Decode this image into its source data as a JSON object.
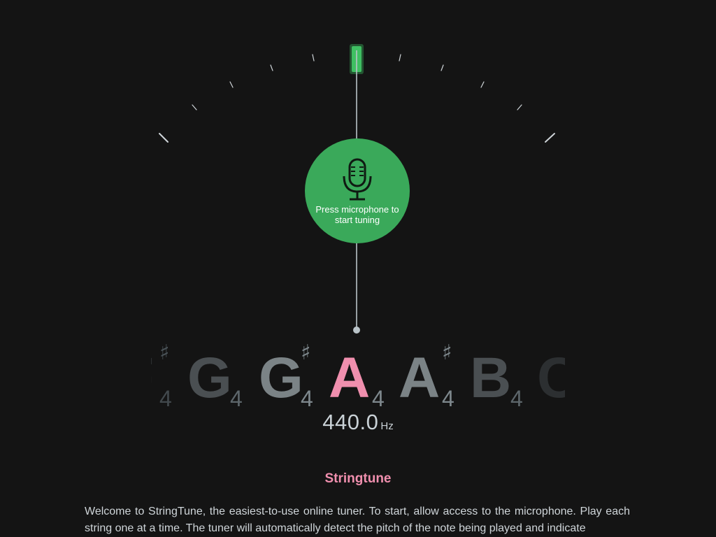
{
  "colors": {
    "background": "#141414",
    "accent_green": "#3aa95a",
    "active_note_pink": "#f08fae",
    "tick": "#cfd5d9",
    "needle": "#b9c3c8",
    "text": "#cfd5d9"
  },
  "tuner": {
    "mic_button": {
      "icon": "microphone-icon",
      "label": "Press microphone to start tuning"
    },
    "notes": [
      {
        "letter": "F",
        "sharp": "♯",
        "octave": "4",
        "state": "faded"
      },
      {
        "letter": "G",
        "sharp": "",
        "octave": "4",
        "state": "dim"
      },
      {
        "letter": "G",
        "sharp": "♯",
        "octave": "4",
        "state": "neighbor"
      },
      {
        "letter": "A",
        "sharp": "",
        "octave": "4",
        "state": "active"
      },
      {
        "letter": "A",
        "sharp": "♯",
        "octave": "4",
        "state": "neighbor"
      },
      {
        "letter": "B",
        "sharp": "",
        "octave": "4",
        "state": "dim"
      },
      {
        "letter": "C",
        "sharp": "",
        "octave": "",
        "state": "faded"
      }
    ],
    "frequency": {
      "value": "440.0",
      "unit": "Hz"
    }
  },
  "content": {
    "title": "Stringtune",
    "intro": "Welcome to StringTune, the easiest-to-use online tuner. To start, allow access to the microphone. Play each string one at a time. The tuner will automatically detect the pitch of the note being played and indicate"
  }
}
